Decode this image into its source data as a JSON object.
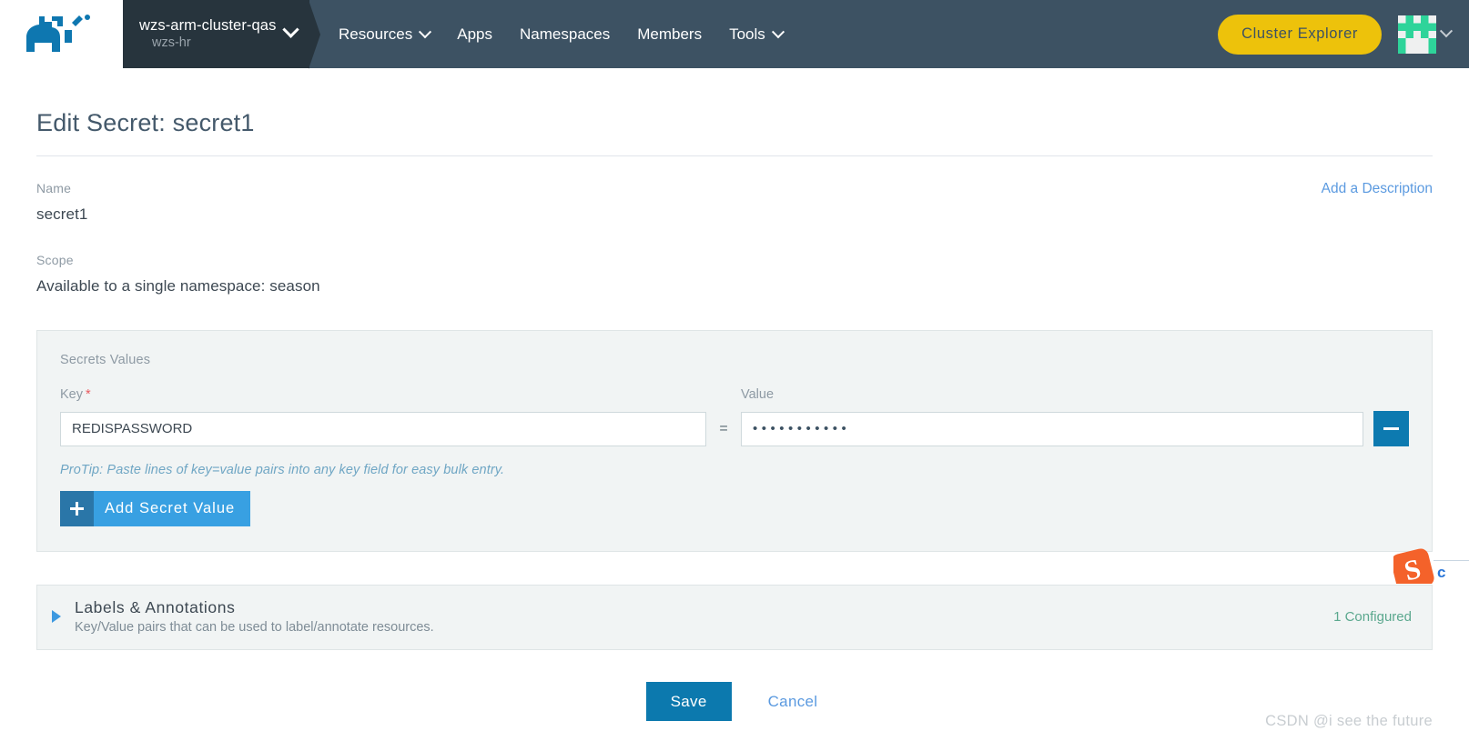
{
  "header": {
    "logo_icon": "rancher-cow-logo",
    "cluster": {
      "name": "wzs-arm-cluster-qas",
      "sub": "wzs-hr",
      "chevron_icon": "chevron-down-icon"
    },
    "nav": [
      {
        "label": "Resources",
        "has_chevron": true
      },
      {
        "label": "Apps",
        "has_chevron": false
      },
      {
        "label": "Namespaces",
        "has_chevron": false
      },
      {
        "label": "Members",
        "has_chevron": false
      },
      {
        "label": "Tools",
        "has_chevron": true
      }
    ],
    "cluster_explorer_label": "Cluster Explorer",
    "avatar_icon": "user-identicon-avatar",
    "avatar_chevron_icon": "chevron-down-icon",
    "colors": {
      "bar": "#3d5263",
      "cluster_bg": "#27343d",
      "explorer_button": "#edc20b",
      "avatar_green": "#2ed49a"
    }
  },
  "page": {
    "title": "Edit Secret: secret1",
    "name_label": "Name",
    "name_value": "secret1",
    "add_description_label": "Add a Description",
    "scope_label": "Scope",
    "scope_value": "Available to a single namespace: season"
  },
  "secrets_panel": {
    "title": "Secrets Values",
    "key_header": "Key",
    "key_required_mark": "*",
    "value_header": "Value",
    "equals_sign": "=",
    "rows": [
      {
        "key": "REDISPASSWORD",
        "value_masked": "•••••••••••",
        "remove_icon": "minus-icon"
      }
    ],
    "protip": "ProTip: Paste lines of key=value pairs into any key field for easy bulk entry.",
    "add_button_label": "Add Secret Value",
    "add_button_icon": "plus-icon"
  },
  "labels_annotations": {
    "expand_icon": "triangle-right-icon",
    "title": "Labels & Annotations",
    "subtitle": "Key/Value pairs that can be used to label/annotate resources.",
    "status": "1 Configured",
    "status_color": "#5ba88e"
  },
  "footer": {
    "save_label": "Save",
    "cancel_label": "Cancel"
  },
  "watermark": {
    "text": "CSDN @i see the future"
  },
  "sticker": {
    "icon": "sogou-input-logo",
    "letter": "S",
    "tail_text": "c"
  }
}
